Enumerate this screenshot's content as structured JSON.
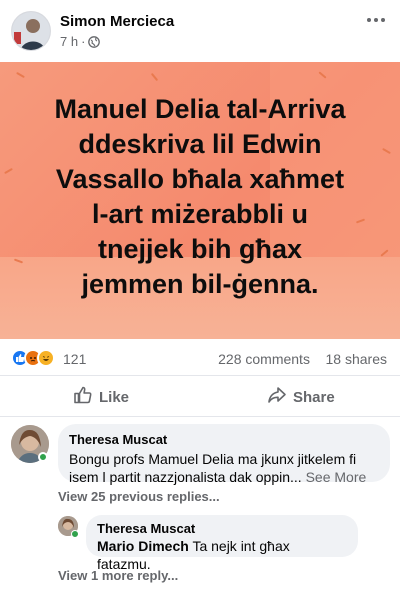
{
  "post": {
    "author": "Simon Mercieca",
    "time": "7 h",
    "separator": "·",
    "image_text_lines": [
      "Manuel Delia tal-Arriva",
      "ddeskriva lil Edwin",
      "Vassallo bħala xaħmet",
      "l-art miżerabbli u",
      "tnejjek bih għax",
      "jemmen bil-ġenna."
    ]
  },
  "reactions": {
    "count": "121",
    "comments": "228 comments",
    "shares": "18 shares"
  },
  "actions": {
    "like_label": "Like",
    "share_label": "Share"
  },
  "comments": [
    {
      "name": "Theresa Muscat",
      "text": "Bongu profs Mamuel Delia ma jkunx jitkelem fi isem l partit nazzjonalista dak oppin...",
      "see_more": "See More",
      "view_previous": "View 25 previous replies..."
    },
    {
      "name": "Theresa Muscat",
      "mention": "Mario Dimech",
      "text": "Ta nejk int għax fatazmu.",
      "view_more": "View 1 more reply..."
    }
  ],
  "colors": {
    "brand_blue": "#1877f2",
    "image_bg": "#f58a6e",
    "online_green": "#31a24c"
  }
}
